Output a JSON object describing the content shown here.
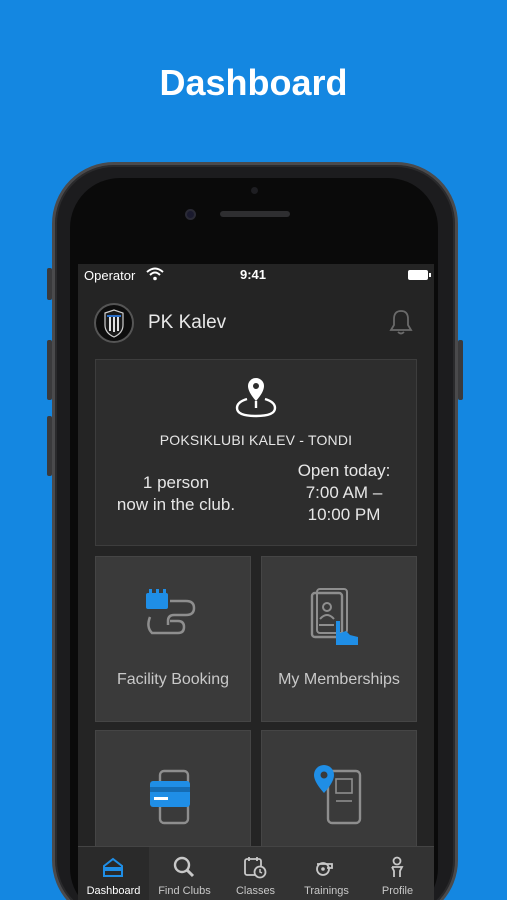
{
  "headline": "Dashboard",
  "status_bar": {
    "carrier": "Operator",
    "time": "9:41"
  },
  "header": {
    "club_name": "PK Kalev"
  },
  "club_card": {
    "club_full_name": "POKSIKLUBI KALEV - TONDI",
    "occupancy_line1": "1 person",
    "occupancy_line2": "now in the club.",
    "hours_title": "Open today:",
    "hours_open": "7:00 AM –",
    "hours_close": "10:00 PM"
  },
  "tiles": [
    {
      "label": "Facility Booking",
      "icon": "calendar-booking-icon"
    },
    {
      "label": "My Memberships",
      "icon": "membership-card-icon"
    },
    {
      "label": "",
      "icon": "payment-card-icon"
    },
    {
      "label": "",
      "icon": "location-phone-icon"
    }
  ],
  "tabs": [
    {
      "label": "Dashboard",
      "icon": "home-icon",
      "active": true
    },
    {
      "label": "Find Clubs",
      "icon": "search-icon",
      "active": false
    },
    {
      "label": "Classes",
      "icon": "calendar-clock-icon",
      "active": false
    },
    {
      "label": "Trainings",
      "icon": "whistle-icon",
      "active": false
    },
    {
      "label": "Profile",
      "icon": "person-icon",
      "active": false
    }
  ],
  "colors": {
    "background": "#1487e1",
    "accent": "#1f8ee6",
    "screen": "#242424"
  }
}
